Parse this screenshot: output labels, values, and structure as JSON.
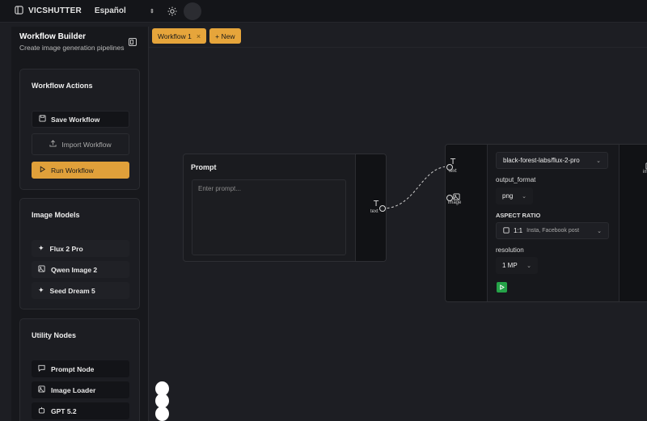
{
  "topbar": {
    "brand": "VICSHUTTER",
    "language": "Español"
  },
  "sidebar": {
    "title": "Workflow Builder",
    "subtitle": "Create image generation pipelines",
    "sections": {
      "actions": {
        "title": "Workflow Actions",
        "save": "Save Workflow",
        "import": "Import Workflow",
        "run": "Run Workflow"
      },
      "models": {
        "title": "Image Models",
        "items": [
          "Flux 2 Pro",
          "Qwen Image 2",
          "Seed Dream 5"
        ]
      },
      "utility": {
        "title": "Utility Nodes",
        "items": [
          "Prompt Node",
          "Image Loader",
          "GPT 5.2"
        ]
      }
    }
  },
  "tabs": {
    "workflow": "Workflow 1",
    "close": "×",
    "new": "+ New"
  },
  "prompt_node": {
    "title": "Prompt",
    "placeholder": "Enter prompt...",
    "output_label": "text"
  },
  "model_node": {
    "model": "black-forest-labs/flux-2-pro",
    "inputs": {
      "text": "text",
      "image": "image"
    },
    "output_format_label": "output_format",
    "output_format": "png",
    "aspect_ratio_label": "ASPECT RATIO",
    "aspect_ratio_value": "1:1",
    "aspect_ratio_hint": "Insta, Facebook post",
    "resolution_label": "resolution",
    "resolution": "1 MP",
    "output_label": "im"
  },
  "colors": {
    "accent": "#e0a03a",
    "run": "#25a348",
    "bg": "#1d1e23"
  }
}
